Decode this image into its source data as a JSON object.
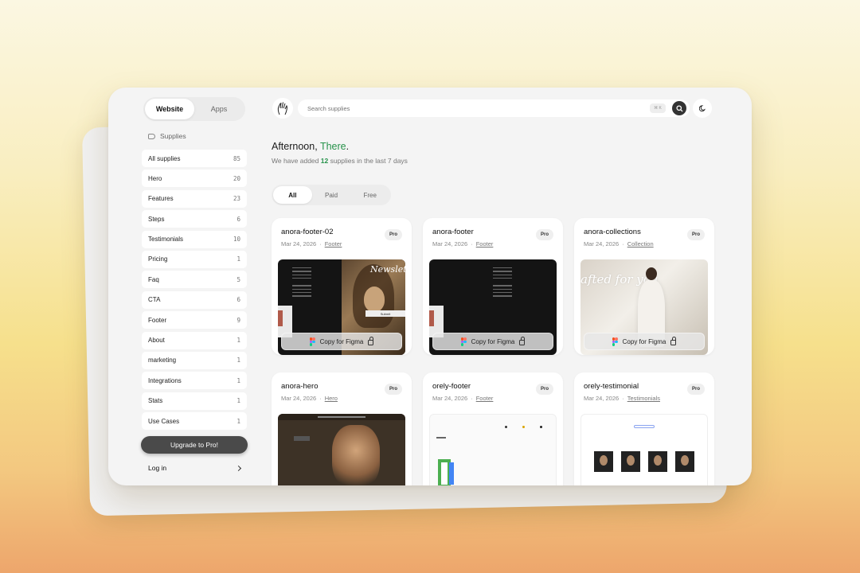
{
  "tabs": [
    {
      "label": "Website"
    },
    {
      "label": "Apps"
    }
  ],
  "sidebar": {
    "section_label": "Supplies",
    "items": [
      {
        "label": "All supplies",
        "count": "85"
      },
      {
        "label": "Hero",
        "count": "20"
      },
      {
        "label": "Features",
        "count": "23"
      },
      {
        "label": "Steps",
        "count": "6"
      },
      {
        "label": "Testimonials",
        "count": "10"
      },
      {
        "label": "Pricing",
        "count": "1"
      },
      {
        "label": "Faq",
        "count": "5"
      },
      {
        "label": "CTA",
        "count": "6"
      },
      {
        "label": "Footer",
        "count": "9"
      },
      {
        "label": "About",
        "count": "1"
      },
      {
        "label": "marketing",
        "count": "1"
      },
      {
        "label": "Integrations",
        "count": "1"
      },
      {
        "label": "Stats",
        "count": "1"
      },
      {
        "label": "Use Cases",
        "count": "1"
      }
    ],
    "upgrade_label": "Upgrade to Pro!",
    "login_label": "Log in"
  },
  "search": {
    "placeholder": "Search supplies"
  },
  "greeting": {
    "prefix": "Afternoon, ",
    "name": "There",
    "suffix": "."
  },
  "subtitle": {
    "before": "We have added ",
    "count": "12",
    "after": " supplies in the last 7 days"
  },
  "filters": [
    {
      "label": "All"
    },
    {
      "label": "Paid"
    },
    {
      "label": "Free"
    }
  ],
  "cards": [
    {
      "title": "anora-footer-02",
      "date": "Mar 24, 2026",
      "category": "Footer",
      "badge": "Pro",
      "copy_label": "Copy for Figma",
      "preview_text": "Newsletter",
      "preview_button": "Submit"
    },
    {
      "title": "anora-footer",
      "date": "Mar 24, 2026",
      "category": "Footer",
      "badge": "Pro",
      "copy_label": "Copy for Figma"
    },
    {
      "title": "anora-collections",
      "date": "Mar 24, 2026",
      "category": "Collection",
      "badge": "Pro",
      "copy_label": "Copy for Figma",
      "preview_text": "afted for you"
    },
    {
      "title": "anora-hero",
      "date": "Mar 24, 2026",
      "category": "Hero",
      "badge": "Pro"
    },
    {
      "title": "orely-footer",
      "date": "Mar 24, 2026",
      "category": "Footer",
      "badge": "Pro"
    },
    {
      "title": "orely-testimonial",
      "date": "Mar 24, 2026",
      "category": "Testimonials",
      "badge": "Pro"
    }
  ],
  "colors": {
    "accent": "#26924a",
    "upgrade_bg": "#4a4a4a"
  },
  "icons": {
    "theme": "moon-icon",
    "search": "search-icon",
    "logo": "hand-logo-icon"
  }
}
